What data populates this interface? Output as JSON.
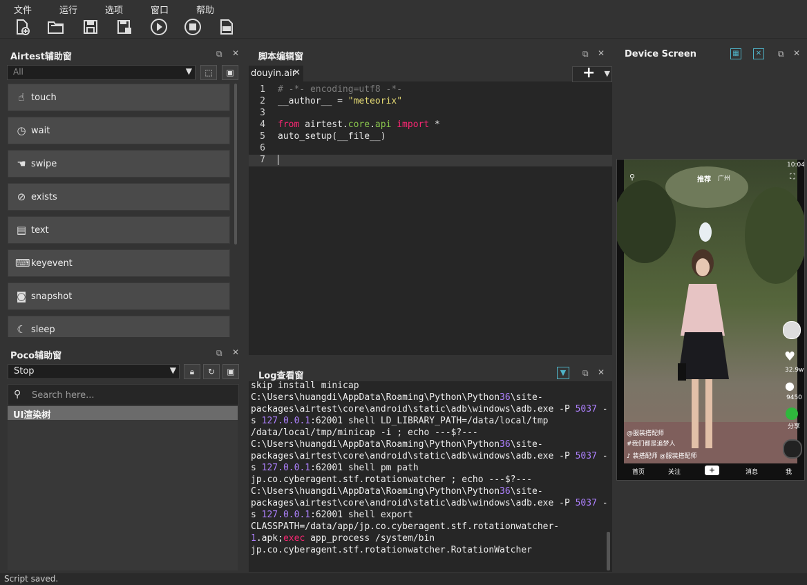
{
  "menu": [
    "文件",
    "运行",
    "选项",
    "窗口",
    "帮助"
  ],
  "toolbar_icons": [
    "new-file-icon",
    "open-folder-icon",
    "save-icon",
    "save-as-icon",
    "run-icon",
    "stop-icon",
    "log-icon"
  ],
  "airtest": {
    "title": "Airtest辅助窗",
    "filter_value": "All",
    "items": [
      {
        "label": "touch",
        "icon": "touch-hand-icon"
      },
      {
        "label": "wait",
        "icon": "clock-icon"
      },
      {
        "label": "swipe",
        "icon": "swipe-hand-icon"
      },
      {
        "label": "exists",
        "icon": "check-search-icon"
      },
      {
        "label": "text",
        "icon": "text-box-icon"
      },
      {
        "label": "keyevent",
        "icon": "keyboard-icon"
      },
      {
        "label": "snapshot",
        "icon": "camera-icon"
      },
      {
        "label": "sleep",
        "icon": "moon-icon"
      }
    ]
  },
  "poco": {
    "title": "Poco辅助窗",
    "mode_value": "Stop",
    "search_placeholder": "Search here...",
    "tree_root": "UI渲染树"
  },
  "editor": {
    "title": "脚本编辑窗",
    "tab_label": "douyin.air",
    "tab_close": "✕",
    "add_label": "+",
    "lines": [
      {
        "n": "1",
        "parts": [
          {
            "t": "# -*- encoding=utf8 -*-",
            "c": "cm"
          }
        ]
      },
      {
        "n": "2",
        "parts": [
          {
            "t": "__author__ = ",
            "c": ""
          },
          {
            "t": "\"meteorix\"",
            "c": "st"
          }
        ]
      },
      {
        "n": "3",
        "parts": []
      },
      {
        "n": "4",
        "parts": [
          {
            "t": "from",
            "c": "kw"
          },
          {
            "t": " airtest.",
            "c": ""
          },
          {
            "t": "core",
            "c": "mod"
          },
          {
            "t": ".",
            "c": ""
          },
          {
            "t": "api",
            "c": "mod"
          },
          {
            "t": " ",
            "c": ""
          },
          {
            "t": "import",
            "c": "kw"
          },
          {
            "t": " *",
            "c": ""
          }
        ]
      },
      {
        "n": "5",
        "parts": [
          {
            "t": "auto_setup(__file__)",
            "c": ""
          }
        ]
      },
      {
        "n": "6",
        "parts": []
      },
      {
        "n": "7",
        "parts": []
      }
    ]
  },
  "log": {
    "title": "Log查看窗",
    "lines": [
      [
        {
          "t": "skip install minicap",
          "c": ""
        }
      ],
      [
        {
          "t": "C:\\Users\\huangdi\\AppData\\Roaming\\Python\\Python",
          "c": ""
        },
        {
          "t": "36",
          "c": "num"
        },
        {
          "t": "\\site-",
          "c": ""
        }
      ],
      [
        {
          "t": "packages\\airtest\\core\\android\\static\\adb\\windows\\adb.exe -P ",
          "c": ""
        },
        {
          "t": "5037",
          "c": "num"
        },
        {
          "t": " -",
          "c": ""
        }
      ],
      [
        {
          "t": "s ",
          "c": ""
        },
        {
          "t": "127.0.0.1",
          "c": "num"
        },
        {
          "t": ":62001 shell LD_LIBRARY_PATH=/data/local/tmp",
          "c": ""
        }
      ],
      [
        {
          "t": "/data/local/tmp/minicap -i ; echo ---$?---",
          "c": ""
        }
      ],
      [
        {
          "t": "C:\\Users\\huangdi\\AppData\\Roaming\\Python\\Python",
          "c": ""
        },
        {
          "t": "36",
          "c": "num"
        },
        {
          "t": "\\site-",
          "c": ""
        }
      ],
      [
        {
          "t": "packages\\airtest\\core\\android\\static\\adb\\windows\\adb.exe -P ",
          "c": ""
        },
        {
          "t": "5037",
          "c": "num"
        },
        {
          "t": " -",
          "c": ""
        }
      ],
      [
        {
          "t": "s ",
          "c": ""
        },
        {
          "t": "127.0.0.1",
          "c": "num"
        },
        {
          "t": ":62001 shell pm path",
          "c": ""
        }
      ],
      [
        {
          "t": "jp.co.cyberagent.stf.rotationwatcher ; echo ---$?---",
          "c": ""
        }
      ],
      [
        {
          "t": "C:\\Users\\huangdi\\AppData\\Roaming\\Python\\Python",
          "c": ""
        },
        {
          "t": "36",
          "c": "num"
        },
        {
          "t": "\\site-",
          "c": ""
        }
      ],
      [
        {
          "t": "packages\\airtest\\core\\android\\static\\adb\\windows\\adb.exe -P ",
          "c": ""
        },
        {
          "t": "5037",
          "c": "num"
        },
        {
          "t": " -",
          "c": ""
        }
      ],
      [
        {
          "t": "s ",
          "c": ""
        },
        {
          "t": "127.0.0.1",
          "c": "num"
        },
        {
          "t": ":62001 shell export",
          "c": ""
        }
      ],
      [
        {
          "t": "CLASSPATH=/data/app/jp.co.cyberagent.stf.rotationwatcher-",
          "c": ""
        }
      ],
      [
        {
          "t": "1",
          "c": "num"
        },
        {
          "t": ".apk;",
          "c": ""
        },
        {
          "t": "exec",
          "c": "kw"
        },
        {
          "t": " app_process /system/bin",
          "c": ""
        }
      ],
      [
        {
          "t": "jp.co.cyberagent.stf.rotationwatcher.RotationWatcher",
          "c": ""
        }
      ]
    ]
  },
  "device": {
    "title": "Device Screen",
    "time": "10:04",
    "top_tabs": [
      "推荐",
      "广州"
    ],
    "like_count": "32.9w",
    "comment_count": "9450",
    "share_label": "分享",
    "author": "@服装搭配师",
    "caption": "#我们都是追梦人",
    "music": "♪ 装搭配师   @服装搭配师",
    "bottom_nav": [
      "首页",
      "关注",
      "+",
      "消息",
      "我"
    ]
  },
  "status": "Script saved.",
  "colors": {
    "bg": "#333333",
    "editor_bg": "#262626",
    "keyword": "#f92672",
    "string": "#e6db74",
    "number": "#ae81ff",
    "comment": "#7a7a7a"
  }
}
